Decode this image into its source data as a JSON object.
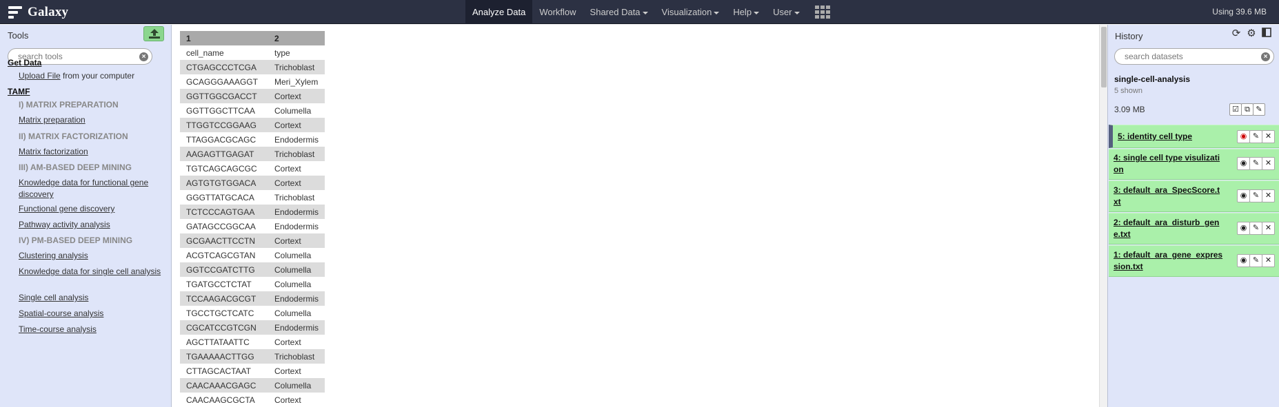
{
  "masthead": {
    "brand": "Galaxy",
    "nav": [
      {
        "label": "Analyze Data",
        "active": true,
        "caret": false
      },
      {
        "label": "Workflow",
        "active": false,
        "caret": false
      },
      {
        "label": "Shared Data",
        "active": false,
        "caret": true
      },
      {
        "label": "Visualization",
        "active": false,
        "caret": true
      },
      {
        "label": "Help",
        "active": false,
        "caret": true
      },
      {
        "label": "User",
        "active": false,
        "caret": true
      }
    ],
    "quota": "Using 39.6 MB"
  },
  "tools": {
    "title": "Tools",
    "search_placeholder": "search tools",
    "get_data": "Get Data",
    "upload_link": "Upload File",
    "upload_suffix": " from your computer",
    "tamf": "TAMF",
    "labels": {
      "matrix_prep": "I) MATRIX PREPARATION",
      "matrix_fact": "II) MATRIX FACTORIZATION",
      "am_mining": "III) AM-BASED DEEP MINING",
      "pm_mining": "IV) PM-BASED DEEP MINING"
    },
    "links": {
      "matrix_preparation": "Matrix preparation",
      "matrix_factorization": "Matrix factorization",
      "knowledge_functional": "Knowledge data for functional gene discovery",
      "functional_gene": "Functional gene discovery",
      "pathway": "Pathway activity analysis",
      "clustering": "Clustering analysis",
      "knowledge_single_cell": "Knowledge data for single cell analysis",
      "single_cell": "Single cell analysis",
      "spatial": "Spatial-course analysis",
      "time_course": "Time-course analysis"
    }
  },
  "table": {
    "headers": [
      "1",
      "2"
    ],
    "rows": [
      [
        "cell_name",
        "type"
      ],
      [
        "CTGAGCCCTCGA",
        "Trichoblast"
      ],
      [
        "GCAGGGAAAGGT",
        "Meri_Xylem"
      ],
      [
        "GGTTGGCGACCT",
        "Cortext"
      ],
      [
        "GGTTGGCTTCAA",
        "Columella"
      ],
      [
        "TTGGTCCGGAAG",
        "Cortext"
      ],
      [
        "TTAGGACGCAGC",
        "Endodermis"
      ],
      [
        "AAGAGTTGAGAT",
        "Trichoblast"
      ],
      [
        "TGTCAGCAGCGC",
        "Cortext"
      ],
      [
        "AGTGTGTGGACA",
        "Cortext"
      ],
      [
        "GGGTTATGCACA",
        "Trichoblast"
      ],
      [
        "TCTCCCAGTGAA",
        "Endodermis"
      ],
      [
        "GATAGCCGGCAA",
        "Endodermis"
      ],
      [
        "GCGAACTTCCTN",
        "Cortext"
      ],
      [
        "ACGTCAGCGTAN",
        "Columella"
      ],
      [
        "GGTCCGATCTTG",
        "Columella"
      ],
      [
        "TGATGCCTCTAT",
        "Columella"
      ],
      [
        "TCCAAGACGCGT",
        "Endodermis"
      ],
      [
        "TGCCTGCTCATC",
        "Columella"
      ],
      [
        "CGCATCCGTCGN",
        "Endodermis"
      ],
      [
        "AGCTTATAATTC",
        "Cortext"
      ],
      [
        "TGAAAAACTTGG",
        "Trichoblast"
      ],
      [
        "CTTAGCACTAAT",
        "Cortext"
      ],
      [
        "CAACAAACGAGC",
        "Columella"
      ],
      [
        "CAACAAGCGCTA",
        "Cortext"
      ]
    ]
  },
  "history": {
    "title": "History",
    "search_placeholder": "search datasets",
    "name": "single-cell-analysis",
    "shown": "5 shown",
    "size": "3.09 MB",
    "datasets": [
      {
        "title": "5: identity cell type"
      },
      {
        "title": "4: single cell type visulization"
      },
      {
        "title": "3: default_ara_SpecScore.txt"
      },
      {
        "title": "2: default_ara_disturb_gene.txt"
      },
      {
        "title": "1: default_ara_gene_expression.txt"
      }
    ]
  },
  "colors": {
    "masthead_bg": "#2c3143",
    "panel_bg": "#dfe5f9",
    "dataset_ok": "#aaf0aa",
    "upload_btn": "#8bd68e"
  }
}
